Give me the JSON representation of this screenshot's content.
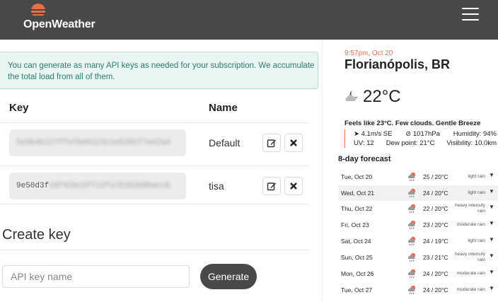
{
  "header": {
    "brand": "OpenWeather",
    "logo_icon": "sunset-logo-icon",
    "menu_icon": "hamburger-icon"
  },
  "api_keys": {
    "alert": "You can generate as many API keys as needed for your subscription. We accumulate the total load from all of them.",
    "col_key": "Key",
    "col_name": "Name",
    "rows": [
      {
        "key_visible": "",
        "key_blurred": "5e5b4b227ffefbd4223c1e5201f7e42ad",
        "name": "Default",
        "edit_icon": "edit-icon",
        "delete_icon": "close-icon"
      },
      {
        "key_visible": "9e50d3f",
        "key_blurred": "18f426c5f712fa76262b0baccb",
        "name": "tisa",
        "edit_icon": "edit-icon",
        "delete_icon": "close-icon"
      }
    ]
  },
  "create": {
    "title": "Create key",
    "placeholder": "API key name",
    "button": "Generate"
  },
  "weather": {
    "time": "9:57pm, Oct 20",
    "city": "Florianópolis, BR",
    "temp": "22°C",
    "icon": "partly-cloudy-night-icon",
    "feels": "Feels like 23°C. Few clouds. Gentle Breeze",
    "wind": "4.1m/s SE",
    "pressure": "1017hPa",
    "humidity": "Humidity: 94%",
    "uv": "UV: 12",
    "dew": "Dew point: 21°C",
    "visibility": "Visibility: 10.0km",
    "forecast_title": "8-day forecast",
    "accent": "#e96e50",
    "forecast": [
      {
        "day": "Tue, Oct 20",
        "temp": "25 / 20°C",
        "desc": "light rain"
      },
      {
        "day": "Wed, Oct 21",
        "temp": "24 / 20°C",
        "desc": "light rain"
      },
      {
        "day": "Thu, Oct 22",
        "temp": "22 / 20°C",
        "desc": "heavy intensity rain"
      },
      {
        "day": "Fri, Oct 23",
        "temp": "23 / 20°C",
        "desc": "moderate rain"
      },
      {
        "day": "Sat, Oct 24",
        "temp": "24 / 19°C",
        "desc": "light rain"
      },
      {
        "day": "Sun, Oct 25",
        "temp": "23 / 21°C",
        "desc": "heavy intensity rain"
      },
      {
        "day": "Mon, Oct 26",
        "temp": "24 / 20°C",
        "desc": "moderate rain"
      },
      {
        "day": "Tue, Oct 27",
        "temp": "24 / 20°C",
        "desc": "moderate rain"
      }
    ]
  }
}
